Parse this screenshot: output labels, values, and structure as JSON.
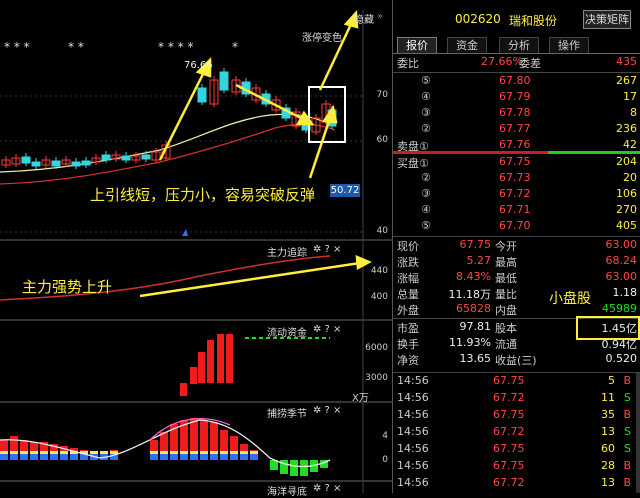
{
  "chart": {
    "hidden_label": "隐藏",
    "limit_label": "涨停变色",
    "max_price_label": "76.66",
    "stars_a": "* * *",
    "stars_b": "* *",
    "stars_c": "* * * *",
    "stars_d": "*",
    "price_axis": [
      "70",
      "60",
      "50.72",
      "40"
    ],
    "price_current": "50.72",
    "annotation_main": "上引线短，压力小，容易突破反弹",
    "annotation_fund": "主力强势上升",
    "colors": {
      "up": "#ff3a3a",
      "down": "#35d5e0",
      "ma_yellow": "#f0f0a0",
      "ma_red": "#d03030"
    }
  },
  "panels": {
    "trace": {
      "title": "主力追踪",
      "axis": [
        "440",
        "400"
      ]
    },
    "flow": {
      "title": "流动资金",
      "axis": [
        "6000",
        "3000"
      ],
      "unit": "X万"
    },
    "season": {
      "title": "捕捞季节",
      "axis": [
        "4",
        "0"
      ]
    },
    "sea": {
      "title": "海洋寻底"
    }
  },
  "quote": {
    "code": "002620",
    "name": "瑞和股份",
    "button": "决策矩阵",
    "tabs": [
      "报价",
      "资金",
      "分析",
      "操作"
    ],
    "weibi_label": "委比",
    "weibi_value": "27.66%",
    "weicha_label": "委差",
    "weicha_value": "435",
    "sell": [
      {
        "level": "⑤",
        "price": "67.80",
        "vol": "267"
      },
      {
        "level": "④",
        "price": "67.79",
        "vol": "17"
      },
      {
        "level": "③",
        "price": "67.78",
        "vol": "8"
      },
      {
        "level": "②",
        "price": "67.77",
        "vol": "236"
      },
      {
        "level": "卖盘①",
        "price": "67.76",
        "vol": "42"
      }
    ],
    "buy": [
      {
        "level": "买盘①",
        "price": "67.75",
        "vol": "204"
      },
      {
        "level": "②",
        "price": "67.73",
        "vol": "20"
      },
      {
        "level": "③",
        "price": "67.72",
        "vol": "106"
      },
      {
        "level": "④",
        "price": "67.71",
        "vol": "270"
      },
      {
        "level": "⑤",
        "price": "67.70",
        "vol": "405"
      }
    ],
    "stats": [
      {
        "l1": "现价",
        "v1": "67.75",
        "l2": "今开",
        "v2": "63.00"
      },
      {
        "l1": "涨跌",
        "v1": "5.27",
        "l2": "最高",
        "v2": "68.24"
      },
      {
        "l1": "涨幅",
        "v1": "8.43%",
        "l2": "最低",
        "v2": "63.00"
      },
      {
        "l1": "总量",
        "v1": "11.18万",
        "l2": "量比",
        "v2": "1.18"
      },
      {
        "l1": "外盘",
        "v1": "65828",
        "l2": "内盘",
        "v2": "45989"
      }
    ],
    "annotation_small": "小盘股",
    "fundamentals": [
      {
        "l1": "市盈",
        "v1": "97.81",
        "l2": "股本",
        "v2": "1.45亿"
      },
      {
        "l1": "换手",
        "v1": "11.93%",
        "l2": "流通",
        "v2": "0.94亿"
      },
      {
        "l1": "净资",
        "v1": "13.65",
        "l2": "收益(三)",
        "v2": "0.520"
      }
    ],
    "ticks": [
      {
        "time": "14:56",
        "price": "67.75",
        "vol": "5",
        "dir": "B"
      },
      {
        "time": "14:56",
        "price": "67.72",
        "vol": "11",
        "dir": "S"
      },
      {
        "time": "14:56",
        "price": "67.75",
        "vol": "35",
        "dir": "B"
      },
      {
        "time": "14:56",
        "price": "67.72",
        "vol": "13",
        "dir": "S"
      },
      {
        "time": "14:56",
        "price": "67.75",
        "vol": "60",
        "dir": "S"
      },
      {
        "time": "14:56",
        "price": "67.75",
        "vol": "28",
        "dir": "B"
      },
      {
        "time": "14:56",
        "price": "67.72",
        "vol": "13",
        "dir": "B"
      }
    ]
  }
}
